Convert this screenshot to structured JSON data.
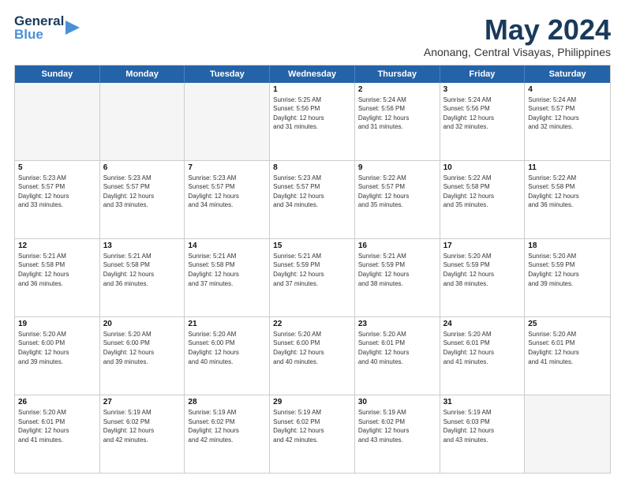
{
  "header": {
    "logo_line1": "General",
    "logo_line2": "Blue",
    "month_title": "May 2024",
    "location": "Anonang, Central Visayas, Philippines"
  },
  "weekdays": [
    "Sunday",
    "Monday",
    "Tuesday",
    "Wednesday",
    "Thursday",
    "Friday",
    "Saturday"
  ],
  "rows": [
    [
      {
        "day": "",
        "info": ""
      },
      {
        "day": "",
        "info": ""
      },
      {
        "day": "",
        "info": ""
      },
      {
        "day": "1",
        "info": "Sunrise: 5:25 AM\nSunset: 5:56 PM\nDaylight: 12 hours\nand 31 minutes."
      },
      {
        "day": "2",
        "info": "Sunrise: 5:24 AM\nSunset: 5:56 PM\nDaylight: 12 hours\nand 31 minutes."
      },
      {
        "day": "3",
        "info": "Sunrise: 5:24 AM\nSunset: 5:56 PM\nDaylight: 12 hours\nand 32 minutes."
      },
      {
        "day": "4",
        "info": "Sunrise: 5:24 AM\nSunset: 5:57 PM\nDaylight: 12 hours\nand 32 minutes."
      }
    ],
    [
      {
        "day": "5",
        "info": "Sunrise: 5:23 AM\nSunset: 5:57 PM\nDaylight: 12 hours\nand 33 minutes."
      },
      {
        "day": "6",
        "info": "Sunrise: 5:23 AM\nSunset: 5:57 PM\nDaylight: 12 hours\nand 33 minutes."
      },
      {
        "day": "7",
        "info": "Sunrise: 5:23 AM\nSunset: 5:57 PM\nDaylight: 12 hours\nand 34 minutes."
      },
      {
        "day": "8",
        "info": "Sunrise: 5:23 AM\nSunset: 5:57 PM\nDaylight: 12 hours\nand 34 minutes."
      },
      {
        "day": "9",
        "info": "Sunrise: 5:22 AM\nSunset: 5:57 PM\nDaylight: 12 hours\nand 35 minutes."
      },
      {
        "day": "10",
        "info": "Sunrise: 5:22 AM\nSunset: 5:58 PM\nDaylight: 12 hours\nand 35 minutes."
      },
      {
        "day": "11",
        "info": "Sunrise: 5:22 AM\nSunset: 5:58 PM\nDaylight: 12 hours\nand 36 minutes."
      }
    ],
    [
      {
        "day": "12",
        "info": "Sunrise: 5:21 AM\nSunset: 5:58 PM\nDaylight: 12 hours\nand 36 minutes."
      },
      {
        "day": "13",
        "info": "Sunrise: 5:21 AM\nSunset: 5:58 PM\nDaylight: 12 hours\nand 36 minutes."
      },
      {
        "day": "14",
        "info": "Sunrise: 5:21 AM\nSunset: 5:58 PM\nDaylight: 12 hours\nand 37 minutes."
      },
      {
        "day": "15",
        "info": "Sunrise: 5:21 AM\nSunset: 5:59 PM\nDaylight: 12 hours\nand 37 minutes."
      },
      {
        "day": "16",
        "info": "Sunrise: 5:21 AM\nSunset: 5:59 PM\nDaylight: 12 hours\nand 38 minutes."
      },
      {
        "day": "17",
        "info": "Sunrise: 5:20 AM\nSunset: 5:59 PM\nDaylight: 12 hours\nand 38 minutes."
      },
      {
        "day": "18",
        "info": "Sunrise: 5:20 AM\nSunset: 5:59 PM\nDaylight: 12 hours\nand 39 minutes."
      }
    ],
    [
      {
        "day": "19",
        "info": "Sunrise: 5:20 AM\nSunset: 6:00 PM\nDaylight: 12 hours\nand 39 minutes."
      },
      {
        "day": "20",
        "info": "Sunrise: 5:20 AM\nSunset: 6:00 PM\nDaylight: 12 hours\nand 39 minutes."
      },
      {
        "day": "21",
        "info": "Sunrise: 5:20 AM\nSunset: 6:00 PM\nDaylight: 12 hours\nand 40 minutes."
      },
      {
        "day": "22",
        "info": "Sunrise: 5:20 AM\nSunset: 6:00 PM\nDaylight: 12 hours\nand 40 minutes."
      },
      {
        "day": "23",
        "info": "Sunrise: 5:20 AM\nSunset: 6:01 PM\nDaylight: 12 hours\nand 40 minutes."
      },
      {
        "day": "24",
        "info": "Sunrise: 5:20 AM\nSunset: 6:01 PM\nDaylight: 12 hours\nand 41 minutes."
      },
      {
        "day": "25",
        "info": "Sunrise: 5:20 AM\nSunset: 6:01 PM\nDaylight: 12 hours\nand 41 minutes."
      }
    ],
    [
      {
        "day": "26",
        "info": "Sunrise: 5:20 AM\nSunset: 6:01 PM\nDaylight: 12 hours\nand 41 minutes."
      },
      {
        "day": "27",
        "info": "Sunrise: 5:19 AM\nSunset: 6:02 PM\nDaylight: 12 hours\nand 42 minutes."
      },
      {
        "day": "28",
        "info": "Sunrise: 5:19 AM\nSunset: 6:02 PM\nDaylight: 12 hours\nand 42 minutes."
      },
      {
        "day": "29",
        "info": "Sunrise: 5:19 AM\nSunset: 6:02 PM\nDaylight: 12 hours\nand 42 minutes."
      },
      {
        "day": "30",
        "info": "Sunrise: 5:19 AM\nSunset: 6:02 PM\nDaylight: 12 hours\nand 43 minutes."
      },
      {
        "day": "31",
        "info": "Sunrise: 5:19 AM\nSunset: 6:03 PM\nDaylight: 12 hours\nand 43 minutes."
      },
      {
        "day": "",
        "info": ""
      }
    ]
  ]
}
